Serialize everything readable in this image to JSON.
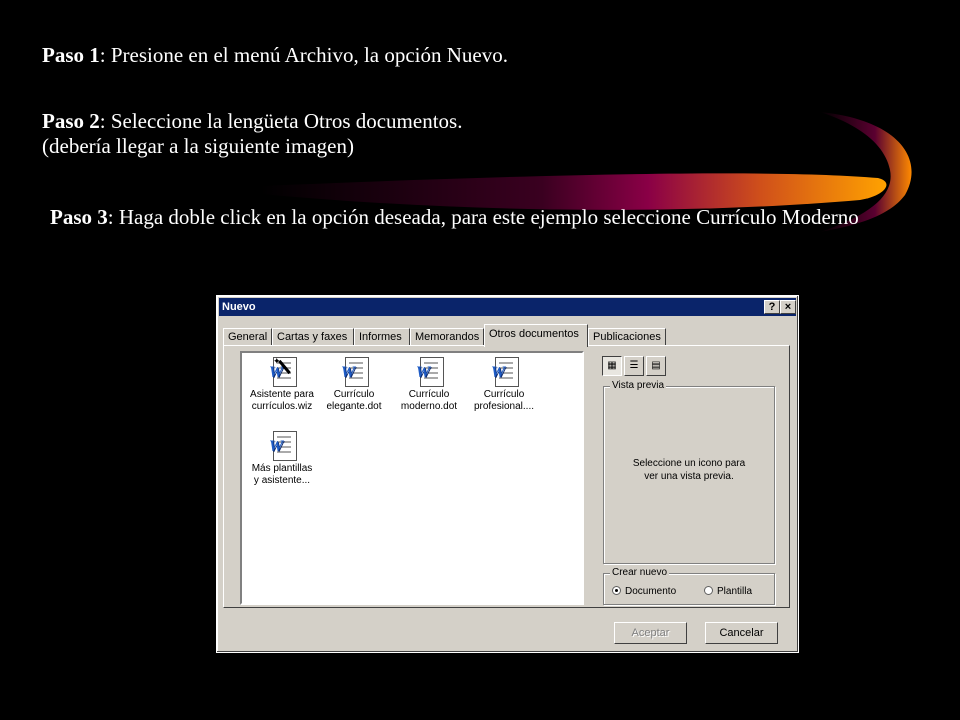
{
  "steps": {
    "step1": {
      "bold": "Paso 1",
      "text": ": Presione en el menú Archivo, la opción Nuevo."
    },
    "step2": {
      "bold": "Paso 2",
      "text": ": Seleccione la lengüeta Otros documentos.",
      "line2": "(debería llegar a la siguiente imagen)"
    },
    "step3": {
      "bold": "Paso 3",
      "text": ": Haga doble click en la opción deseada, para este ejemplo seleccione Currículo Moderno"
    }
  },
  "dialog": {
    "title": "Nuevo",
    "help_btn": "?",
    "close_btn": "×",
    "tabs": [
      {
        "label": "General"
      },
      {
        "label": "Cartas y faxes"
      },
      {
        "label": "Informes"
      },
      {
        "label": "Memorandos"
      },
      {
        "label": "Otros documentos",
        "active": true
      },
      {
        "label": "Publicaciones"
      }
    ],
    "items": [
      {
        "line1": "Asistente para",
        "line2": "currículos.wiz",
        "icon": "word-wizard-icon"
      },
      {
        "line1": "Currículo",
        "line2": "elegante.dot",
        "icon": "word-template-icon"
      },
      {
        "line1": "Currículo",
        "line2": "moderno.dot",
        "icon": "word-template-icon"
      },
      {
        "line1": "Currículo",
        "line2": "profesional....",
        "icon": "word-template-icon"
      },
      {
        "line1": "Más plantillas",
        "line2": "y asistente...",
        "icon": "word-template-icon"
      }
    ],
    "preview": {
      "label": "Vista previa",
      "line1": "Seleccione un icono para",
      "line2": "ver una vista previa."
    },
    "crear_nuevo": {
      "label": "Crear nuevo",
      "options": [
        {
          "label": "Documento",
          "selected": true
        },
        {
          "label": "Plantilla",
          "selected": false
        }
      ]
    },
    "buttons": {
      "ok": "Aceptar",
      "cancel": "Cancelar"
    },
    "view_buttons": [
      "large-icons-view-icon",
      "list-view-icon",
      "details-view-icon"
    ]
  },
  "colors": {
    "background": "#000000",
    "titlebar": "#0a246a",
    "dialog_face": "#d4d0c8",
    "swoosh_orange": "#ff9a00",
    "swoosh_magenta": "#8a0046"
  }
}
